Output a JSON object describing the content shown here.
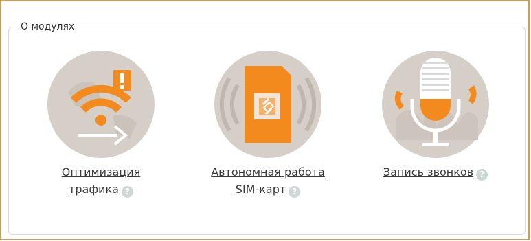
{
  "section": {
    "legend": "О модулях"
  },
  "modules": [
    {
      "line1": "Оптимизация ",
      "line2": "трафика",
      "help": "?",
      "icon": "wifi-warning-icon"
    },
    {
      "line1": "Автономная работа",
      "line2": "SIM-карт",
      "help": "?",
      "icon": "sim-card-icon"
    },
    {
      "line1": "Запись звонков",
      "help": "?",
      "icon": "microphone-icon"
    }
  ],
  "colors": {
    "accent": "#f28a1e",
    "panel_border": "#ef9426",
    "circle": "#d6cfc7",
    "help": "#cfd8d6"
  }
}
